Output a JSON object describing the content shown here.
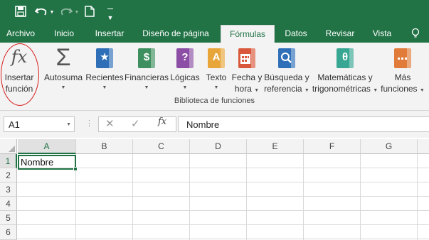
{
  "colors": {
    "brand": "#217346",
    "annotation": "#d81e1e"
  },
  "quick_access": [
    "save-icon",
    "undo-icon",
    "dropdown-caret-icon",
    "redo-icon",
    "new-document-icon",
    "customize-toolbar-icon"
  ],
  "tabs": [
    "Archivo",
    "Inicio",
    "Insertar",
    "Diseño de página",
    "Fórmulas",
    "Datos",
    "Revisar",
    "Vista"
  ],
  "active_tab": "Fórmulas",
  "ribbon": {
    "insert_function": {
      "line1": "Insertar",
      "line2": "función",
      "glyph": "fx"
    },
    "autosum": {
      "label": "Autosuma",
      "glyph": "Σ"
    },
    "recent": {
      "label": "Recientes",
      "glyph": "★"
    },
    "financial": {
      "label": "Financieras",
      "glyph": "$"
    },
    "logical": {
      "label": "Lógicas",
      "glyph": "?"
    },
    "text": {
      "label": "Texto",
      "glyph": "A"
    },
    "datetime": {
      "line1": "Fecha y",
      "line2": "hora"
    },
    "lookup": {
      "line1": "Búsqueda y",
      "line2": "referencia"
    },
    "math": {
      "line1": "Matemáticas y",
      "line2": "trigonométricas",
      "glyph": "θ"
    },
    "more": {
      "line1": "Más",
      "line2": "funciones"
    },
    "group_label": "Biblioteca de funciones"
  },
  "formula_bar": {
    "name_box": "A1",
    "fx_label": "fx",
    "formula": "Nombre"
  },
  "grid": {
    "columns": [
      "A",
      "B",
      "C",
      "D",
      "E",
      "F",
      "G"
    ],
    "rows": [
      "1",
      "2",
      "3",
      "4",
      "5",
      "6"
    ],
    "selected_column": "A",
    "selected_row": "1",
    "cells": {
      "A1": "Nombre"
    }
  }
}
